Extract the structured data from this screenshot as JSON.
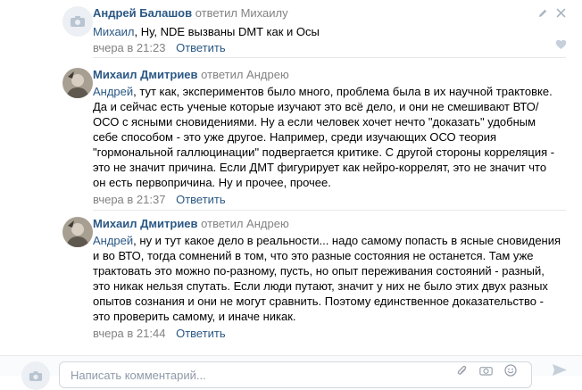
{
  "comments": [
    {
      "author": "Андрей Балашов",
      "replied_text": "ответил Михаилу",
      "addressee": "Михаил",
      "text": ", Ну, NDE вызваны DMT как и Осы",
      "date": "вчера в 21:23",
      "reply_label": "Ответить"
    },
    {
      "author": "Михаил Дмитриев",
      "replied_text": "ответил Андрею",
      "addressee": "Андрей",
      "lines": [
        ", тут как, экспериментов было много, проблема была в их научной трактовке.",
        "Да и сейчас есть ученые которые изучают это всё дело, и они не смешивают ВТО/",
        "ОСО с ясными сновидениями. Ну а если человек хочет нечто \"доказать\" удобным",
        "себе способом - это уже другое. Например, среди изучающих ОСО теория",
        "\"гормональной галлюцинации\" подвергается критике. С другой стороны корреляция -",
        "это не значит причина. Если ДМТ фигурирует как нейро-коррелят, это не значит что",
        "он есть первопричина. Ну и прочее, прочее."
      ],
      "date": "вчера в 21:37",
      "reply_label": "Ответить"
    },
    {
      "author": "Михаил Дмитриев",
      "replied_text": "ответил Андрею",
      "addressee": "Андрей",
      "lines": [
        ", ну и тут какое дело в реальности... надо самому попасть в ясные сновидения",
        "и во ВТО, тогда сомнений в том, что это разные состояния не останется. Там уже",
        "трактовать это можно по-разному, пусть, но опыт переживания состояний - разный,",
        "это никак нельзя спутать. Если люди путают, значит у них не было этих двух разных",
        "опытов сознания и они не могут сравнить. Поэтому единственное доказательство -",
        "это проверить самому, и иначе никак."
      ],
      "date": "вчера в 21:44",
      "reply_label": "Ответить"
    }
  ],
  "compose": {
    "placeholder": "Написать комментарий..."
  },
  "icons": {
    "camera": "camera-icon",
    "edit": "pencil-icon",
    "delete": "close-icon",
    "like": "heart-icon",
    "attach": "paperclip-icon",
    "send": "send-icon"
  },
  "colors": {
    "link": "#2a5885",
    "secondary": "#828282",
    "icon": "#c5d0db"
  }
}
